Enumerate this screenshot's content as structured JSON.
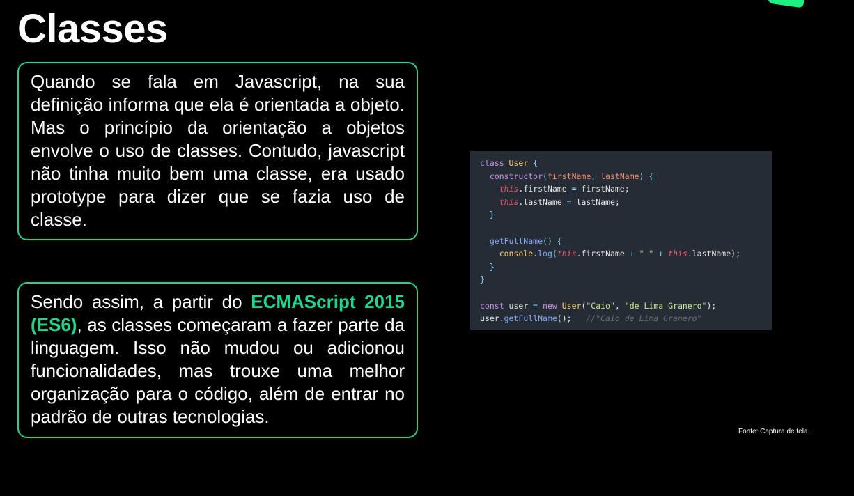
{
  "title": "Classes",
  "paragraph1": "Quando se fala em Javascript, na sua definição informa que ela é orientada a objeto. Mas o princípio da orientação a objetos envolve o uso de classes. Contudo, javascript não tinha muito bem uma classe, era usado prototype para dizer que se fazia uso de classe.",
  "paragraph2": {
    "before": "Sendo assim, a partir do ",
    "highlight": "ECMAScript 2015 (ES6)",
    "after": ", as classes começaram a fazer parte da linguagem. Isso não mudou ou adicionou funcionalidades, mas trouxe uma melhor organização para o código, além de entrar no padrão de outras tecnologias."
  },
  "code_lines": [
    [
      [
        "class ",
        "kw"
      ],
      [
        "User ",
        "cls"
      ],
      [
        "{",
        "br"
      ]
    ],
    [
      [
        "  constructor",
        "kw"
      ],
      [
        "(",
        "br"
      ],
      [
        "firstName",
        "par"
      ],
      [
        ", ",
        "txt"
      ],
      [
        "lastName",
        "par"
      ],
      [
        ") {",
        "br"
      ]
    ],
    [
      [
        "    this",
        "this"
      ],
      [
        ".firstName ",
        "txt"
      ],
      [
        "= ",
        "op"
      ],
      [
        "firstName;",
        "txt"
      ]
    ],
    [
      [
        "    this",
        "this"
      ],
      [
        ".lastName ",
        "txt"
      ],
      [
        "= ",
        "op"
      ],
      [
        "lastName;",
        "txt"
      ]
    ],
    [
      [
        "  }",
        "br"
      ]
    ],
    [
      [
        "",
        "txt"
      ]
    ],
    [
      [
        "  getFullName",
        "fn"
      ],
      [
        "() {",
        "br"
      ]
    ],
    [
      [
        "    console",
        "obj"
      ],
      [
        ".",
        "txt"
      ],
      [
        "log",
        "fn"
      ],
      [
        "(",
        "br"
      ],
      [
        "this",
        "this"
      ],
      [
        ".firstName ",
        "txt"
      ],
      [
        "+ ",
        "op"
      ],
      [
        "\" \" ",
        "str"
      ],
      [
        "+ ",
        "op"
      ],
      [
        "this",
        "this"
      ],
      [
        ".lastName);",
        "txt"
      ]
    ],
    [
      [
        "  }",
        "br"
      ]
    ],
    [
      [
        "}",
        "br"
      ]
    ],
    [
      [
        "",
        "txt"
      ]
    ],
    [
      [
        "const ",
        "kw"
      ],
      [
        "user ",
        "txt"
      ],
      [
        "= ",
        "op"
      ],
      [
        "new ",
        "kw"
      ],
      [
        "User",
        "cls"
      ],
      [
        "(",
        "txt"
      ],
      [
        "\"Caio\"",
        "str"
      ],
      [
        ", ",
        "txt"
      ],
      [
        "\"de Lima Granero\"",
        "str"
      ],
      [
        ");",
        "txt"
      ]
    ],
    [
      [
        "user.",
        "txt"
      ],
      [
        "getFullName",
        "fn"
      ],
      [
        "();   ",
        "txt"
      ],
      [
        "//\"Caio de Lima Granero\"",
        "com"
      ]
    ]
  ],
  "source": "Fonte: Captura de tela.",
  "colors": {
    "accent": "#1fd58f",
    "code_bg": "#262c35"
  }
}
